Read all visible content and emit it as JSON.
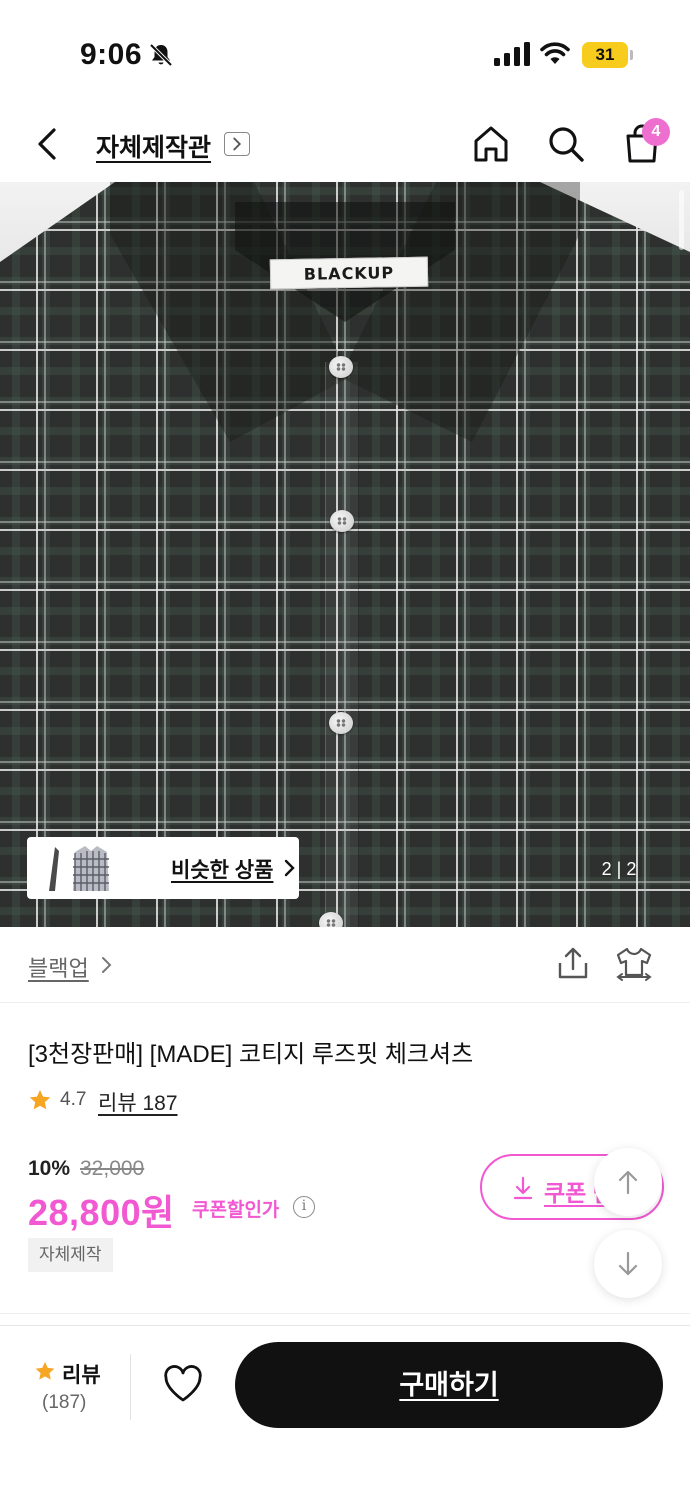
{
  "status_bar": {
    "time": "9:06",
    "battery": "31",
    "icons": [
      "bell-slash-icon",
      "signal-icon",
      "wifi-icon",
      "battery-icon"
    ]
  },
  "nav": {
    "title": "자체제작관",
    "cart_count": "4",
    "icons": [
      "back-icon",
      "chevron-right-icon",
      "home-icon",
      "search-icon",
      "shopping-bag-icon"
    ]
  },
  "hero": {
    "shirt_label": "BLACKUP",
    "similar_label": "비슷한 상품",
    "pager": "2 | 2"
  },
  "brand": {
    "name": "블랙업"
  },
  "product": {
    "name": "[3천장판매] [MADE] 코티지 루즈핏 체크셔츠",
    "rating": "4.7",
    "review_link": "리뷰 187",
    "discount": "10%",
    "original_price": "32,000",
    "price": "28,800원",
    "coupon_note": "쿠폰할인가",
    "tag": "자체제작",
    "coupon_button": "쿠폰 받기"
  },
  "bottom_bar": {
    "review_label": "리뷰",
    "review_count": "(187)",
    "buy_label": "구매하기"
  },
  "colors": {
    "accent": "#f158d2",
    "star": "#f6a623",
    "buy_button": "#111111",
    "badge": "#ef6fd0",
    "battery": "#f7cc1c"
  }
}
